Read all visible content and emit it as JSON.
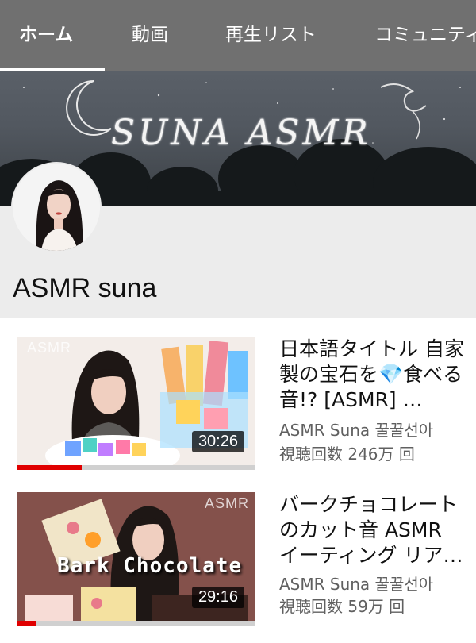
{
  "tabs": [
    {
      "label": "ホーム",
      "active": true
    },
    {
      "label": "動画",
      "active": false
    },
    {
      "label": "再生リスト",
      "active": false
    },
    {
      "label": "コミュニティ",
      "active": false
    }
  ],
  "banner": {
    "title": "SUNA ASMR"
  },
  "channel": {
    "name": "ASMR suna"
  },
  "videos": [
    {
      "title": "日本語タイトル 自家製の宝石を💎食べる音!? [ASMR] …",
      "channel": "ASMR Suna 꿀꿀선아",
      "views": "視聴回数 246万 回",
      "duration": "30:26",
      "watermark": "ASMR",
      "progress": 0.27
    },
    {
      "title": "バークチョコレートのカット音 ASMR イーティング リア…",
      "channel": "ASMR Suna 꿀꿀선아",
      "views": "視聴回数 59万 回",
      "duration": "29:16",
      "watermark": "ASMR",
      "overlay_text": "Bark Chocolate",
      "progress": 0.08
    }
  ],
  "colors": {
    "tab_bar": "#707070",
    "progress": "#e00000",
    "channel_bg": "#ececec"
  }
}
